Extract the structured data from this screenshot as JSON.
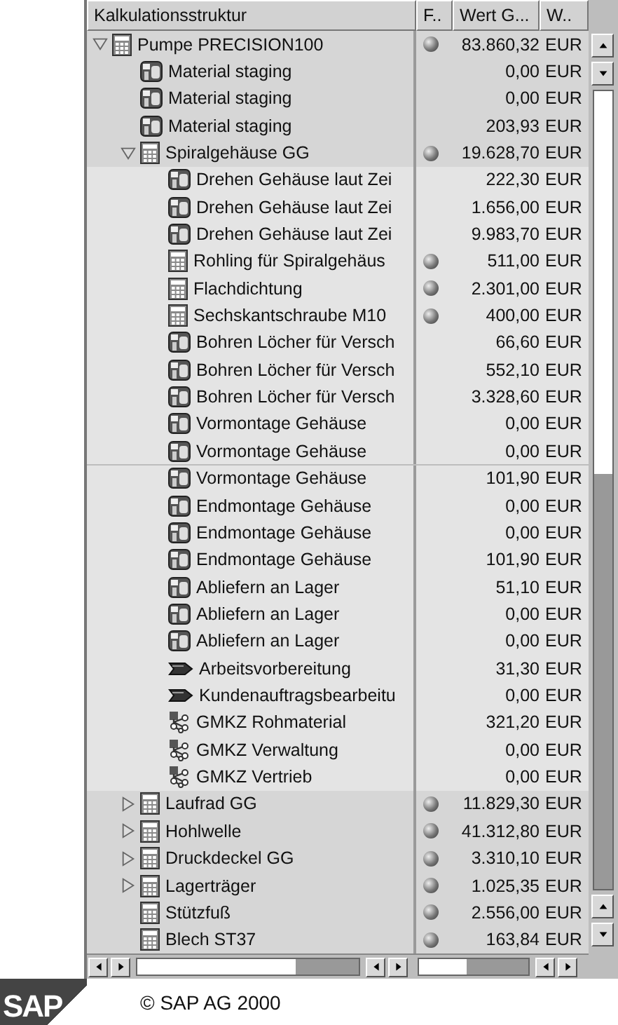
{
  "columns": [
    {
      "label": "Kalkulationsstruktur"
    },
    {
      "label": "F.."
    },
    {
      "label": "Wert G..."
    },
    {
      "label": "W.."
    }
  ],
  "tree": [
    {
      "label": "Pumpe PRECISION100",
      "kind": "material",
      "expanded": true,
      "flagged": true,
      "value": "83.860,32",
      "currency": "EUR",
      "children": [
        {
          "label": "Material staging",
          "kind": "activity",
          "flagged": false,
          "value": "0,00",
          "currency": "EUR"
        },
        {
          "label": "Material staging",
          "kind": "activity",
          "flagged": false,
          "value": "0,00",
          "currency": "EUR"
        },
        {
          "label": "Material staging",
          "kind": "activity",
          "flagged": false,
          "value": "203,93",
          "currency": "EUR"
        },
        {
          "label": "Spiralgehäuse GG",
          "kind": "material",
          "expanded": true,
          "flagged": true,
          "value": "19.628,70",
          "currency": "EUR",
          "children": [
            {
              "label": "Drehen Gehäuse laut Zei",
              "kind": "activity",
              "flagged": false,
              "value": "222,30",
              "currency": "EUR"
            },
            {
              "label": "Drehen Gehäuse laut Zei",
              "kind": "activity",
              "flagged": false,
              "value": "1.656,00",
              "currency": "EUR"
            },
            {
              "label": "Drehen Gehäuse laut Zei",
              "kind": "activity",
              "flagged": false,
              "value": "9.983,70",
              "currency": "EUR"
            },
            {
              "label": "Rohling für Spiralgehäus",
              "kind": "material",
              "flagged": true,
              "value": "511,00",
              "currency": "EUR"
            },
            {
              "label": "Flachdichtung",
              "kind": "material",
              "flagged": true,
              "value": "2.301,00",
              "currency": "EUR"
            },
            {
              "label": "Sechskantschraube M10",
              "kind": "material",
              "flagged": true,
              "value": "400,00",
              "currency": "EUR"
            },
            {
              "label": "Bohren Löcher für Versch",
              "kind": "activity",
              "flagged": false,
              "value": "66,60",
              "currency": "EUR"
            },
            {
              "label": "Bohren Löcher für Versch",
              "kind": "activity",
              "flagged": false,
              "value": "552,10",
              "currency": "EUR"
            },
            {
              "label": "Bohren Löcher für Versch",
              "kind": "activity",
              "flagged": false,
              "value": "3.328,60",
              "currency": "EUR"
            },
            {
              "label": "Vormontage Gehäuse",
              "kind": "activity",
              "flagged": false,
              "value": "0,00",
              "currency": "EUR"
            },
            {
              "label": "Vormontage Gehäuse",
              "kind": "activity",
              "flagged": false,
              "value": "0,00",
              "currency": "EUR"
            },
            {
              "label": "Vormontage Gehäuse",
              "kind": "activity",
              "flagged": false,
              "value": "101,90",
              "currency": "EUR"
            },
            {
              "label": "Endmontage Gehäuse",
              "kind": "activity",
              "flagged": false,
              "value": "0,00",
              "currency": "EUR"
            },
            {
              "label": "Endmontage Gehäuse",
              "kind": "activity",
              "flagged": false,
              "value": "0,00",
              "currency": "EUR"
            },
            {
              "label": "Endmontage Gehäuse",
              "kind": "activity",
              "flagged": false,
              "value": "101,90",
              "currency": "EUR"
            },
            {
              "label": "Abliefern an Lager",
              "kind": "activity",
              "flagged": false,
              "value": "51,10",
              "currency": "EUR"
            },
            {
              "label": "Abliefern an Lager",
              "kind": "activity",
              "flagged": false,
              "value": "0,00",
              "currency": "EUR"
            },
            {
              "label": "Abliefern an Lager",
              "kind": "activity",
              "flagged": false,
              "value": "0,00",
              "currency": "EUR"
            },
            {
              "label": "Arbeitsvorbereitung",
              "kind": "process",
              "flagged": false,
              "value": "31,30",
              "currency": "EUR"
            },
            {
              "label": "Kundenauftragsbearbeitu",
              "kind": "process",
              "flagged": false,
              "value": "0,00",
              "currency": "EUR"
            },
            {
              "label": "GMKZ Rohmaterial",
              "kind": "overhead",
              "flagged": false,
              "value": "321,20",
              "currency": "EUR"
            },
            {
              "label": "GMKZ Verwaltung",
              "kind": "overhead",
              "flagged": false,
              "value": "0,00",
              "currency": "EUR"
            },
            {
              "label": "GMKZ Vertrieb",
              "kind": "overhead",
              "flagged": false,
              "value": "0,00",
              "currency": "EUR"
            }
          ]
        },
        {
          "label": "Laufrad GG",
          "kind": "material",
          "expanded": false,
          "flagged": true,
          "value": "11.829,30",
          "currency": "EUR"
        },
        {
          "label": "Hohlwelle",
          "kind": "material",
          "expanded": false,
          "flagged": true,
          "value": "41.312,80",
          "currency": "EUR"
        },
        {
          "label": "Druckdeckel GG",
          "kind": "material",
          "expanded": false,
          "flagged": true,
          "value": "3.310,10",
          "currency": "EUR"
        },
        {
          "label": "Lagerträger",
          "kind": "material",
          "expanded": false,
          "flagged": true,
          "value": "1.025,35",
          "currency": "EUR"
        },
        {
          "label": "Stützfuß",
          "kind": "material",
          "flagged": true,
          "value": "2.556,00",
          "currency": "EUR"
        },
        {
          "label": "Blech ST37",
          "kind": "material",
          "flagged": true,
          "value": "163,84",
          "currency": "EUR"
        }
      ]
    }
  ],
  "footer": {
    "logo": "SAP",
    "copyright": "© SAP AG 2000"
  }
}
